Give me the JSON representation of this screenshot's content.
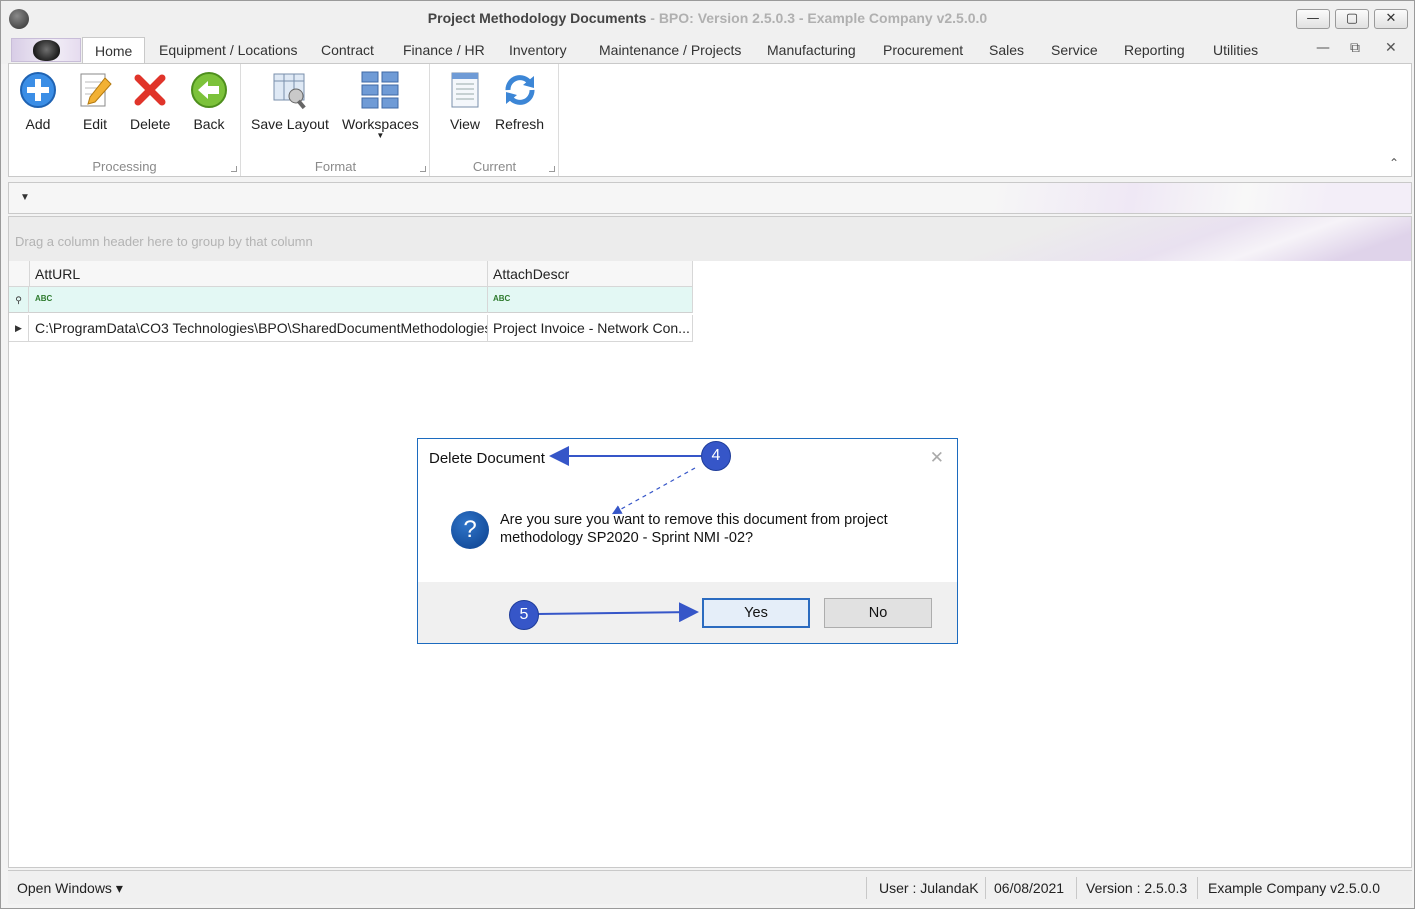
{
  "window": {
    "title_main": "Project Methodology Documents",
    "title_sub": " - BPO: Version 2.5.0.3 - Example Company v2.5.0.0",
    "controls": {
      "minimize": "—",
      "maximize": "▢",
      "close": "✕"
    }
  },
  "tabs": [
    "Home",
    "Equipment / Locations",
    "Contract",
    "Finance / HR",
    "Inventory",
    "Maintenance / Projects",
    "Manufacturing",
    "Procurement",
    "Sales",
    "Service",
    "Reporting",
    "Utilities"
  ],
  "mdi_controls": {
    "minimize": "—",
    "restore": "⧉",
    "close": "✕"
  },
  "ribbon": {
    "groups": {
      "processing": "Processing",
      "format": "Format",
      "current": "Current"
    },
    "buttons": {
      "add": "Add",
      "edit": "Edit",
      "delete": "Delete",
      "back": "Back",
      "save_layout": "Save Layout",
      "workspaces": "Workspaces",
      "view": "View",
      "refresh": "Refresh"
    },
    "collapse_glyph": "⌃"
  },
  "quick_toolbar": {
    "dropdown_glyph": "▼"
  },
  "grid": {
    "group_panel_hint": "Drag a column header here to group by that column",
    "columns": [
      "AttURL",
      "AttachDescr"
    ],
    "filter_glyph": "ABC",
    "rows": [
      [
        "C:\\ProgramData\\CO3 Technologies\\BPO\\SharedDocumentMethodologies...",
        "Project Invoice - Network Con..."
      ]
    ]
  },
  "dialog": {
    "title": "Delete Document",
    "close_glyph": "✕",
    "icon_glyph": "?",
    "message": "Are you sure you want to remove this document from project methodology SP2020 - Sprint NMI -02?",
    "yes": "Yes",
    "no": "No"
  },
  "callouts": {
    "step_4": "4",
    "step_5": "5"
  },
  "colors": {
    "callout": "#3656c8",
    "dialog_border": "#1c6bbf"
  },
  "statusbar": {
    "open_windows": "Open Windows ▾",
    "user": "User : JulandaK",
    "date": "06/08/2021",
    "version": "Version : 2.5.0.3",
    "company": "Example Company v2.5.0.0"
  }
}
